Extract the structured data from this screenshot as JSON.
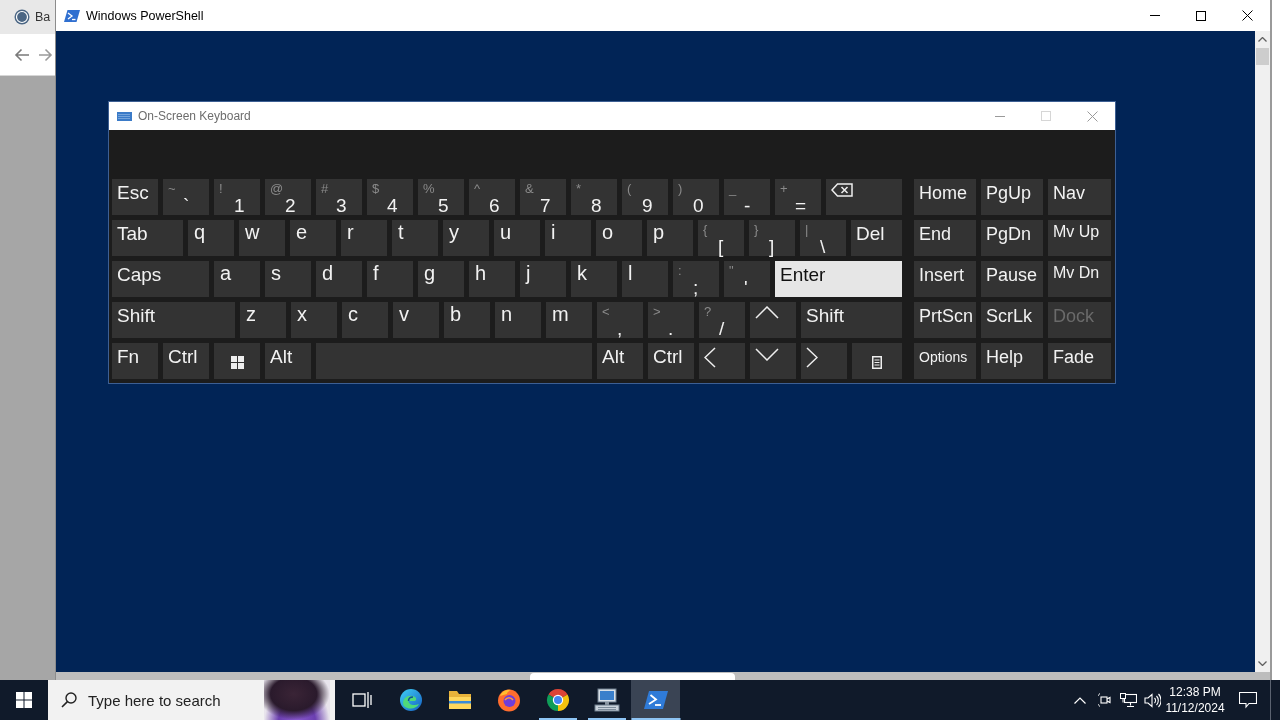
{
  "browser": {
    "tab_title": "Ba"
  },
  "console_window": {
    "title": "Windows PowerShell"
  },
  "osk": {
    "title": "On-Screen Keyboard",
    "main_rows": [
      [
        {
          "kind": "label",
          "label": "Esc",
          "highlighted": false
        },
        {
          "kind": "dual",
          "shift": "~",
          "label": "`",
          "highlighted": false
        },
        {
          "kind": "dual",
          "shift": "!",
          "label": "1",
          "highlighted": false
        },
        {
          "kind": "dual",
          "shift": "@",
          "label": "2",
          "highlighted": false
        },
        {
          "kind": "dual",
          "shift": "#",
          "label": "3",
          "highlighted": false
        },
        {
          "kind": "dual",
          "shift": "$",
          "label": "4",
          "highlighted": false
        },
        {
          "kind": "dual",
          "shift": "%",
          "label": "5",
          "highlighted": false
        },
        {
          "kind": "dual",
          "shift": "^",
          "label": "6",
          "highlighted": false
        },
        {
          "kind": "dual",
          "shift": "&",
          "label": "7",
          "highlighted": false
        },
        {
          "kind": "dual",
          "shift": "*",
          "label": "8",
          "highlighted": false
        },
        {
          "kind": "dual",
          "shift": "(",
          "label": "9",
          "highlighted": false
        },
        {
          "kind": "dual",
          "shift": ")",
          "label": "0",
          "highlighted": false
        },
        {
          "kind": "dual",
          "shift": "_",
          "label": "-",
          "highlighted": false
        },
        {
          "kind": "dual",
          "shift": "+",
          "label": "=",
          "highlighted": false
        },
        {
          "kind": "backspace",
          "highlighted": false
        }
      ],
      [
        {
          "kind": "label",
          "label": "Tab",
          "highlighted": false
        },
        {
          "kind": "letter",
          "label": "q",
          "highlighted": false
        },
        {
          "kind": "letter",
          "label": "w",
          "highlighted": false
        },
        {
          "kind": "letter",
          "label": "e",
          "highlighted": false
        },
        {
          "kind": "letter",
          "label": "r",
          "highlighted": false
        },
        {
          "kind": "letter",
          "label": "t",
          "highlighted": false
        },
        {
          "kind": "letter",
          "label": "y",
          "highlighted": false
        },
        {
          "kind": "letter",
          "label": "u",
          "highlighted": false
        },
        {
          "kind": "letter",
          "label": "i",
          "highlighted": false
        },
        {
          "kind": "letter",
          "label": "o",
          "highlighted": false
        },
        {
          "kind": "letter",
          "label": "p",
          "highlighted": false
        },
        {
          "kind": "dual",
          "shift": "{",
          "label": "[",
          "highlighted": false
        },
        {
          "kind": "dual",
          "shift": "}",
          "label": "]",
          "highlighted": false
        },
        {
          "kind": "dual",
          "shift": "|",
          "label": "\\",
          "highlighted": false
        },
        {
          "kind": "label",
          "label": "Del",
          "highlighted": false
        }
      ],
      [
        {
          "kind": "label",
          "label": "Caps",
          "highlighted": false
        },
        {
          "kind": "letter",
          "label": "a",
          "highlighted": false
        },
        {
          "kind": "letter",
          "label": "s",
          "highlighted": false
        },
        {
          "kind": "letter",
          "label": "d",
          "highlighted": false
        },
        {
          "kind": "letter",
          "label": "f",
          "highlighted": false
        },
        {
          "kind": "letter",
          "label": "g",
          "highlighted": false
        },
        {
          "kind": "letter",
          "label": "h",
          "highlighted": false
        },
        {
          "kind": "letter",
          "label": "j",
          "highlighted": false
        },
        {
          "kind": "letter",
          "label": "k",
          "highlighted": false
        },
        {
          "kind": "letter",
          "label": "l",
          "highlighted": false
        },
        {
          "kind": "dual",
          "shift": ":",
          "label": ";",
          "highlighted": false
        },
        {
          "kind": "dual",
          "shift": "\"",
          "label": "'",
          "highlighted": false
        },
        {
          "kind": "label",
          "label": "Enter",
          "highlighted": true
        }
      ],
      [
        {
          "kind": "label",
          "label": "Shift",
          "highlighted": false
        },
        {
          "kind": "letter",
          "label": "z",
          "highlighted": false
        },
        {
          "kind": "letter",
          "label": "x",
          "highlighted": false
        },
        {
          "kind": "letter",
          "label": "c",
          "highlighted": false
        },
        {
          "kind": "letter",
          "label": "v",
          "highlighted": false
        },
        {
          "kind": "letter",
          "label": "b",
          "highlighted": false
        },
        {
          "kind": "letter",
          "label": "n",
          "highlighted": false
        },
        {
          "kind": "letter",
          "label": "m",
          "highlighted": false
        },
        {
          "kind": "dual",
          "shift": "<",
          "label": ",",
          "highlighted": false
        },
        {
          "kind": "dual",
          "shift": ">",
          "label": ".",
          "highlighted": false
        },
        {
          "kind": "dual",
          "shift": "?",
          "label": "/",
          "highlighted": false
        },
        {
          "kind": "up",
          "highlighted": false
        },
        {
          "kind": "label",
          "label": "Shift",
          "highlighted": false
        }
      ],
      [
        {
          "kind": "label",
          "label": "Fn",
          "highlighted": false
        },
        {
          "kind": "label",
          "label": "Ctrl",
          "highlighted": false
        },
        {
          "kind": "windows",
          "highlighted": false
        },
        {
          "kind": "label",
          "label": "Alt",
          "highlighted": false
        },
        {
          "kind": "space",
          "highlighted": false
        },
        {
          "kind": "label",
          "label": "Alt",
          "highlighted": false
        },
        {
          "kind": "label",
          "label": "Ctrl",
          "highlighted": false
        },
        {
          "kind": "left",
          "highlighted": false
        },
        {
          "kind": "down",
          "highlighted": false
        },
        {
          "kind": "right",
          "highlighted": false
        },
        {
          "kind": "menu",
          "highlighted": false
        }
      ]
    ],
    "side_rows": [
      [
        {
          "kind": "label",
          "label": "Home",
          "disabled": false
        },
        {
          "kind": "label",
          "label": "PgUp",
          "disabled": false
        },
        {
          "kind": "label",
          "label": "Nav",
          "disabled": false
        }
      ],
      [
        {
          "kind": "label",
          "label": "End",
          "disabled": false
        },
        {
          "kind": "label",
          "label": "PgDn",
          "disabled": false
        },
        {
          "kind": "small",
          "label": "Mv Up",
          "disabled": false
        }
      ],
      [
        {
          "kind": "label",
          "label": "Insert",
          "disabled": false
        },
        {
          "kind": "label",
          "label": "Pause",
          "disabled": false
        },
        {
          "kind": "small",
          "label": "Mv Dn",
          "disabled": false
        }
      ],
      [
        {
          "kind": "label",
          "label": "PrtScn",
          "disabled": false
        },
        {
          "kind": "label",
          "label": "ScrLk",
          "disabled": false
        },
        {
          "kind": "label",
          "label": "Dock",
          "disabled": true
        }
      ],
      [
        {
          "kind": "tiny",
          "label": "Options",
          "disabled": false
        },
        {
          "kind": "label",
          "label": "Help",
          "disabled": false
        },
        {
          "kind": "label",
          "label": "Fade",
          "disabled": false
        }
      ]
    ]
  },
  "taskbar": {
    "search": {
      "placeholder": "Type here to search"
    },
    "apps": [
      {
        "kind": "edge",
        "running": false,
        "active": false
      },
      {
        "kind": "explorer",
        "running": false,
        "active": false
      },
      {
        "kind": "firefox",
        "running": false,
        "active": false
      },
      {
        "kind": "chrome",
        "running": true,
        "active": false
      },
      {
        "kind": "osk",
        "running": true,
        "active": false
      },
      {
        "kind": "powershell",
        "running": true,
        "active": true
      }
    ],
    "clock": {
      "time": "12:38 PM",
      "date": "11/12/2024"
    }
  }
}
